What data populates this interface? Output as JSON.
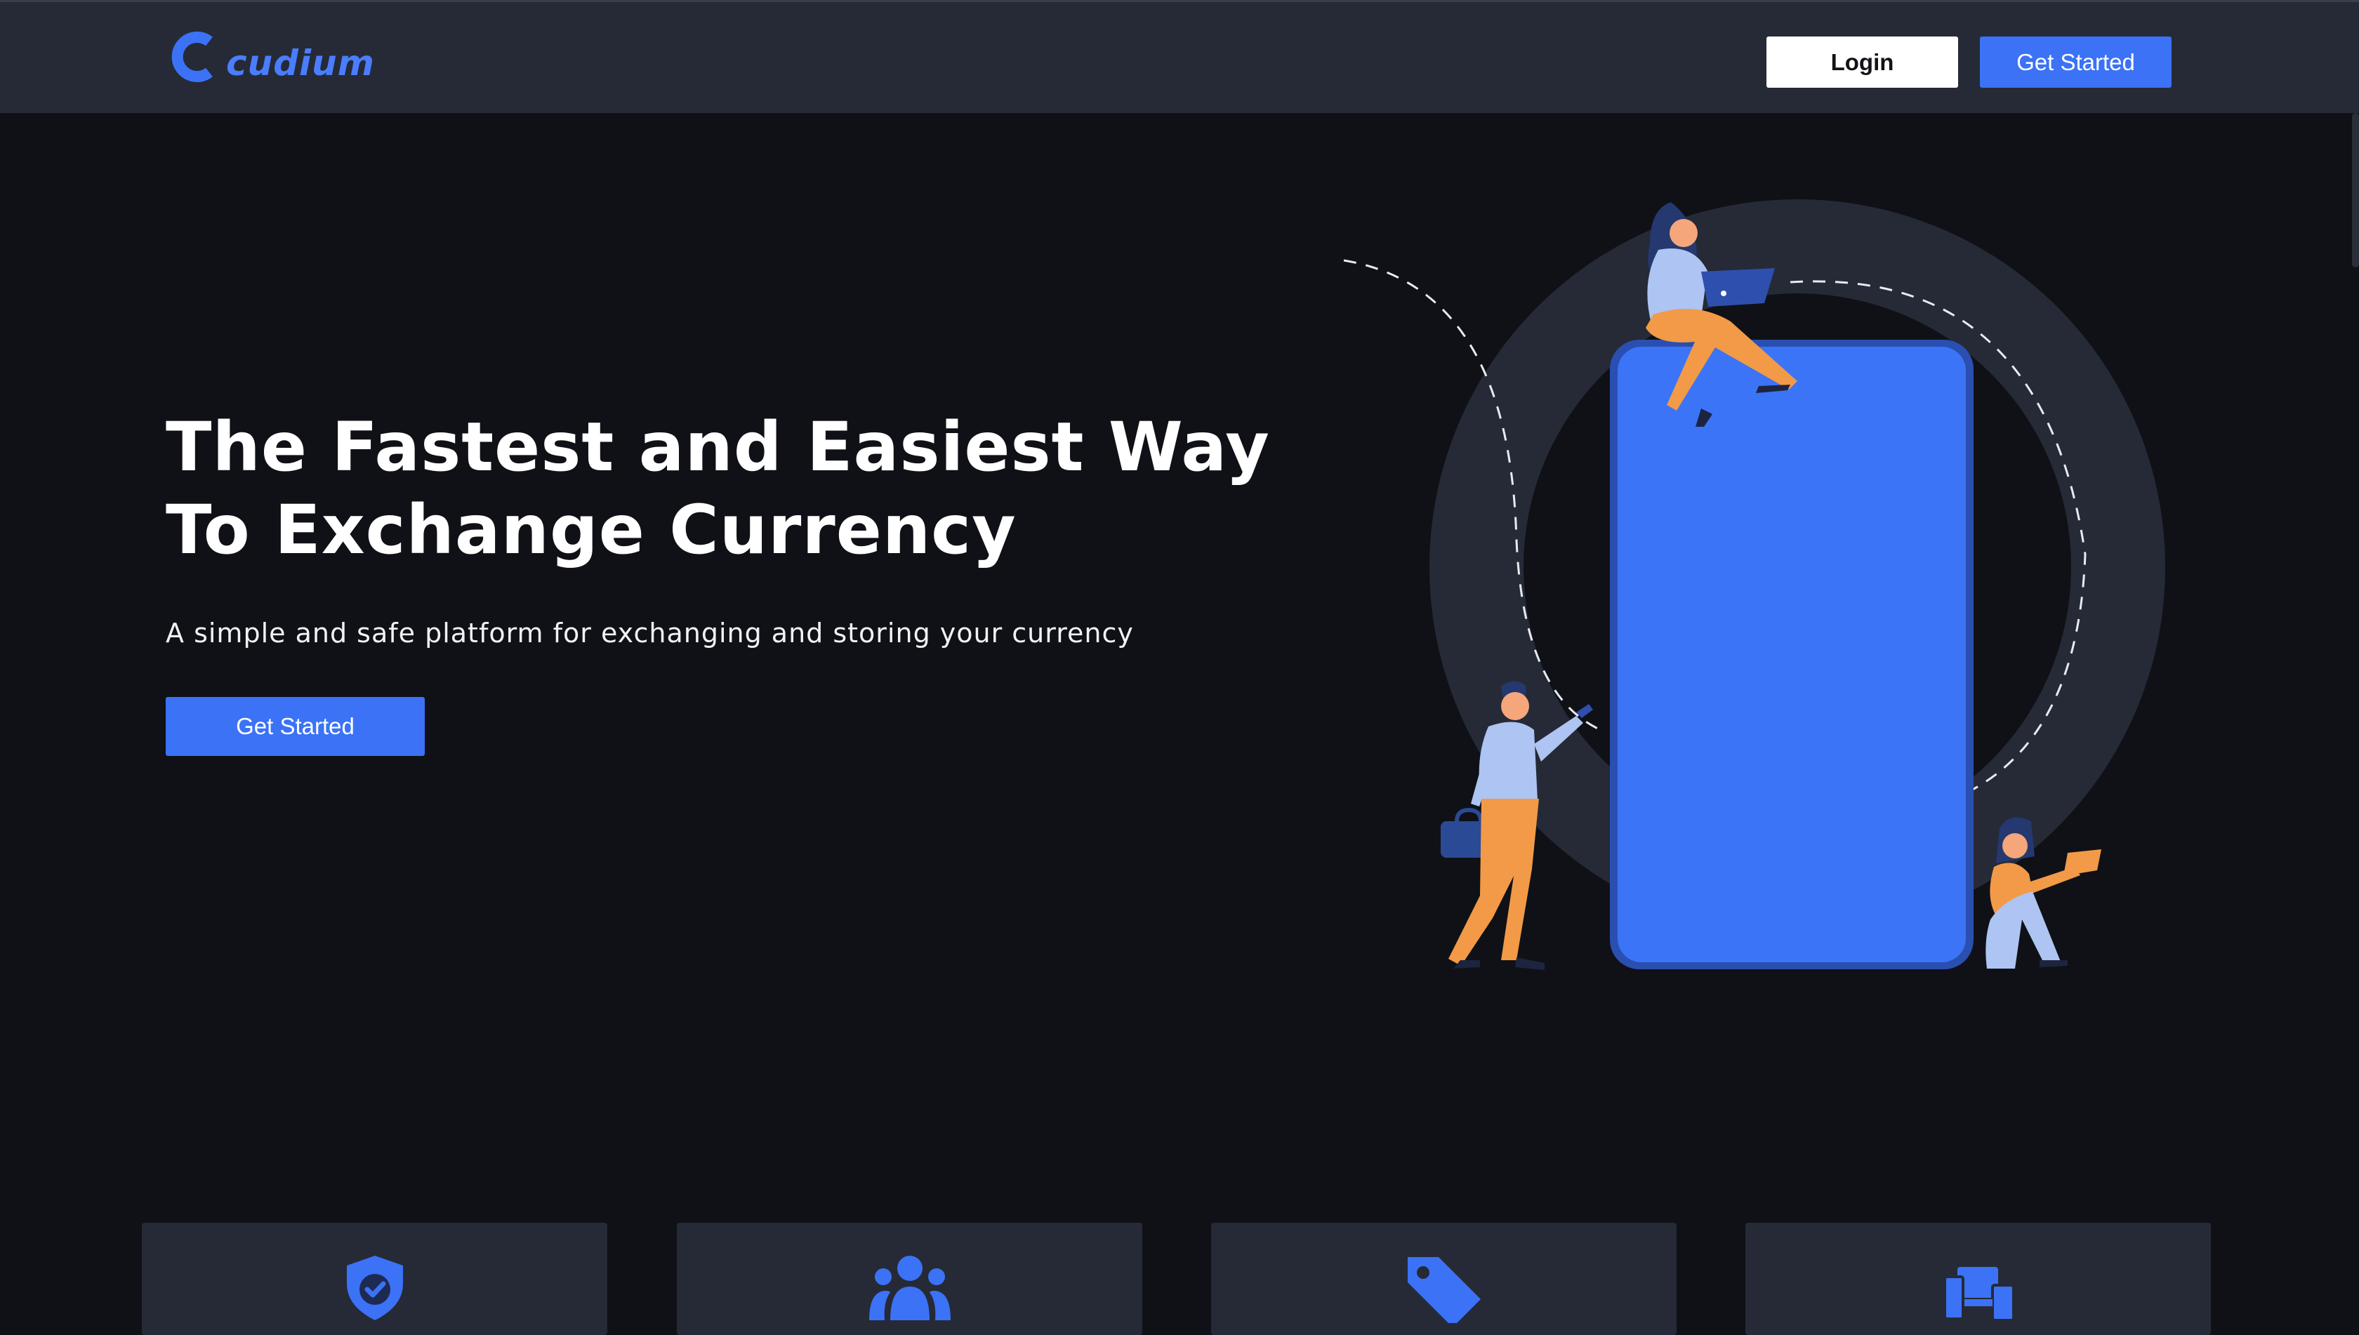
{
  "brand": {
    "name": "cudium",
    "accent": "#3b72f6"
  },
  "nav": {
    "login_label": "Login",
    "get_started_label": "Get Started"
  },
  "hero": {
    "title": "The Fastest and Easiest Way To Exchange Currency",
    "subtitle": "A simple and safe platform for exchanging and storing your currency",
    "cta_label": "Get Started"
  },
  "features": [
    {
      "icon": "shield-check-icon"
    },
    {
      "icon": "users-icon"
    },
    {
      "icon": "tag-icon"
    },
    {
      "icon": "devices-icon"
    }
  ]
}
